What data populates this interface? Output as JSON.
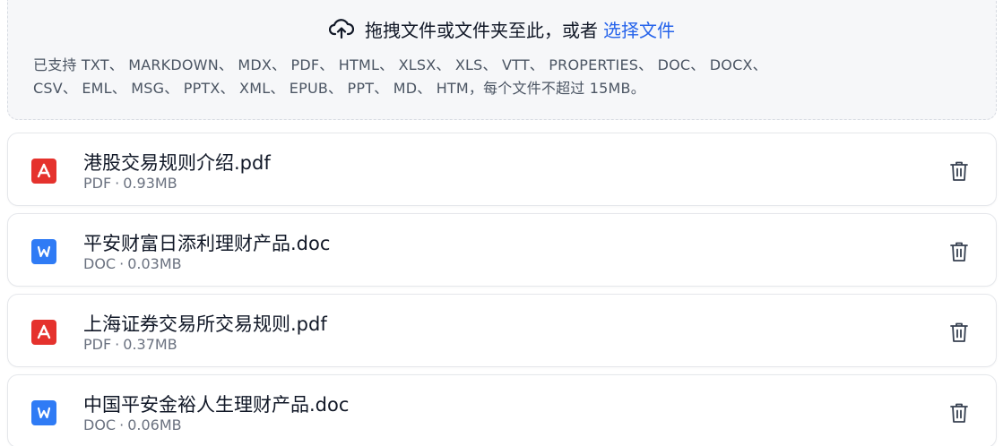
{
  "upload": {
    "prompt_text": "拖拽文件或文件夹至此，或者",
    "select_link": "选择文件",
    "formats_line1": "已支持 TXT、 MARKDOWN、 MDX、 PDF、 HTML、 XLSX、 XLS、 VTT、 PROPERTIES、 DOC、 DOCX、",
    "formats_line2": "CSV、 EML、 MSG、 PPTX、 XML、 EPUB、 PPT、 MD、 HTM，每个文件不超过 15MB。",
    "icon": "cloud-upload-icon"
  },
  "files": [
    {
      "name": "港股交易规则介绍.pdf",
      "type": "PDF",
      "size": "0.93MB",
      "icon": "pdf-icon",
      "color": "#e5322d"
    },
    {
      "name": "平安财富日添利理财产品.doc",
      "type": "DOC",
      "size": "0.03MB",
      "icon": "word-doc-icon",
      "color": "#2f7bf5"
    },
    {
      "name": "上海证券交易所交易规则.pdf",
      "type": "PDF",
      "size": "0.37MB",
      "icon": "pdf-icon",
      "color": "#e5322d"
    },
    {
      "name": "中国平安金裕人生理财产品.doc",
      "type": "DOC",
      "size": "0.06MB",
      "icon": "word-doc-icon",
      "color": "#2f7bf5"
    }
  ],
  "meta_separator": "·",
  "delete_icon": "trash-icon"
}
